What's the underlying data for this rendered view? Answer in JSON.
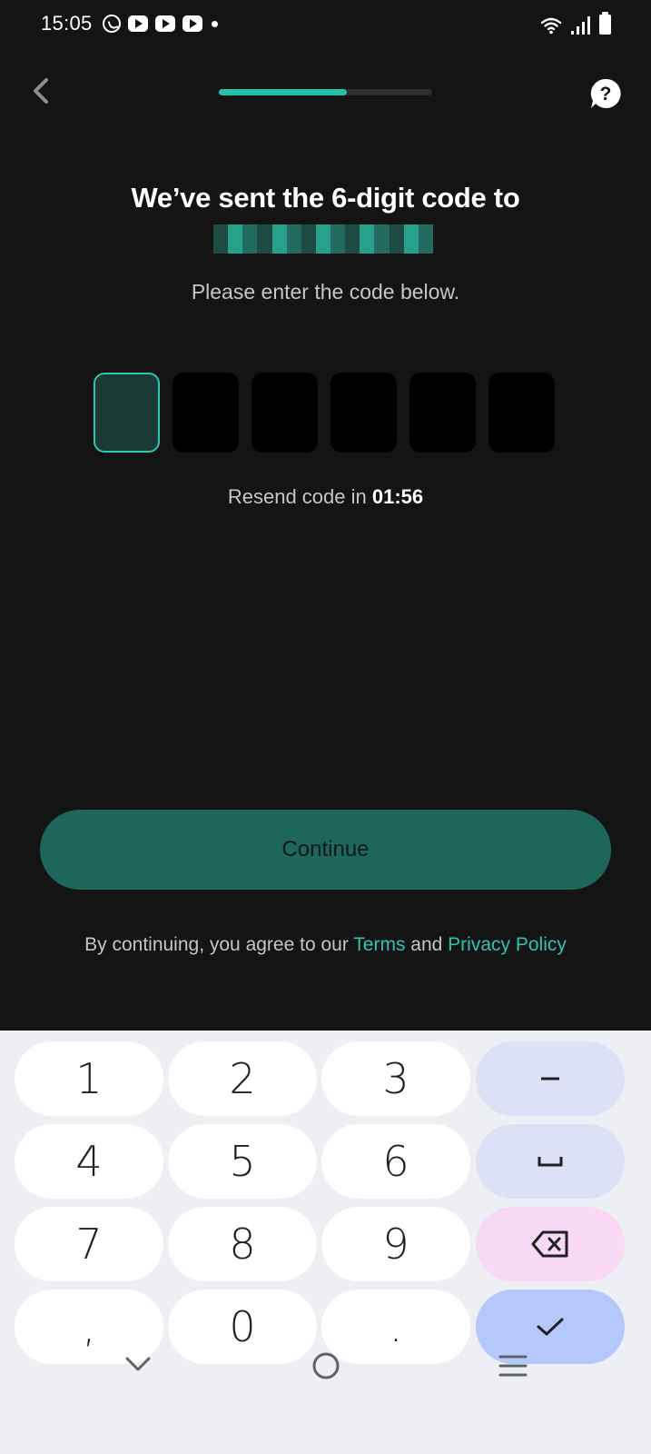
{
  "status_bar": {
    "time": "15:05",
    "left_icons": [
      "whatsapp-icon",
      "youtube-icon",
      "youtube-icon",
      "youtube-icon",
      "notification-dot-icon"
    ],
    "right_icons": [
      "wifi-icon",
      "signal-icon",
      "battery-icon"
    ]
  },
  "header": {
    "back_icon": "chevron-left-icon",
    "progress": 0.6,
    "help_icon": "question-bubble-icon"
  },
  "main": {
    "title": "We’ve sent the 6-digit code to",
    "subtitle": "Please enter the code below.",
    "code_length": 6,
    "code_values": [
      "",
      "",
      "",
      "",
      "",
      ""
    ],
    "resend_text": "Resend code in ",
    "resend_timer": "01:56",
    "continue_label": "Continue",
    "legal_prefix": "By continuing, you agree to our ",
    "terms_label": "Terms",
    "and_label": " and ",
    "privacy_label": "Privacy Policy"
  },
  "keyboard": {
    "keys": [
      {
        "label": "1",
        "name": "key-1"
      },
      {
        "label": "2",
        "name": "key-2"
      },
      {
        "label": "3",
        "name": "key-3"
      },
      {
        "label": "–",
        "name": "key-dash"
      },
      {
        "label": "4",
        "name": "key-4"
      },
      {
        "label": "5",
        "name": "key-5"
      },
      {
        "label": "6",
        "name": "key-6"
      },
      {
        "label": "␣",
        "name": "key-space"
      },
      {
        "label": "7",
        "name": "key-7"
      },
      {
        "label": "8",
        "name": "key-8"
      },
      {
        "label": "9",
        "name": "key-9"
      },
      {
        "label": "⌫",
        "name": "key-backspace"
      },
      {
        "label": ",",
        "name": "key-comma"
      },
      {
        "label": "0",
        "name": "key-0"
      },
      {
        "label": ".",
        "name": "key-period"
      },
      {
        "label": "✓",
        "name": "key-done"
      }
    ]
  },
  "nav_bar": {
    "icons": [
      "chevron-down-icon",
      "home-circle-icon",
      "recent-apps-icon"
    ]
  },
  "colors": {
    "background": "#141414",
    "accent": "#24c2ad",
    "button": "#1e6659",
    "link": "#2fc4b0"
  }
}
